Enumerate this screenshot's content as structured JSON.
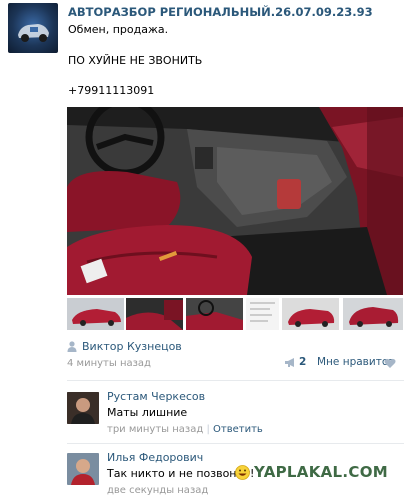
{
  "post": {
    "title": "АВТОРАЗБОР РЕГИОНАЛЬНЫЙ.26.07.09.23.93",
    "line1": "Обмен, продажа.",
    "line2": "ПО ХУЙНЕ НЕ ЗВОНИТЬ",
    "line3": "+79911113091",
    "author": "Виктор Кузнецов",
    "time": "4 минуты назад",
    "shares": "2",
    "like_label": "Мне нравится"
  },
  "comments": [
    {
      "name": "Рустам Черкесов",
      "text": "Маты лишние",
      "time": "три минуты назад",
      "reply": "Ответить"
    },
    {
      "name": "Илья Федорович",
      "text": "Так никто и не позвонит!",
      "time": "две секунды назад"
    }
  ],
  "watermark": "YAPLAKAL.COM",
  "colors": {
    "link": "#2b587a",
    "muted": "#999999",
    "seat_red": "#8a1428",
    "car_red": "#b21e35"
  },
  "icons": [
    "user-icon",
    "megaphone-icon",
    "heart-icon",
    "smiley-icon"
  ]
}
